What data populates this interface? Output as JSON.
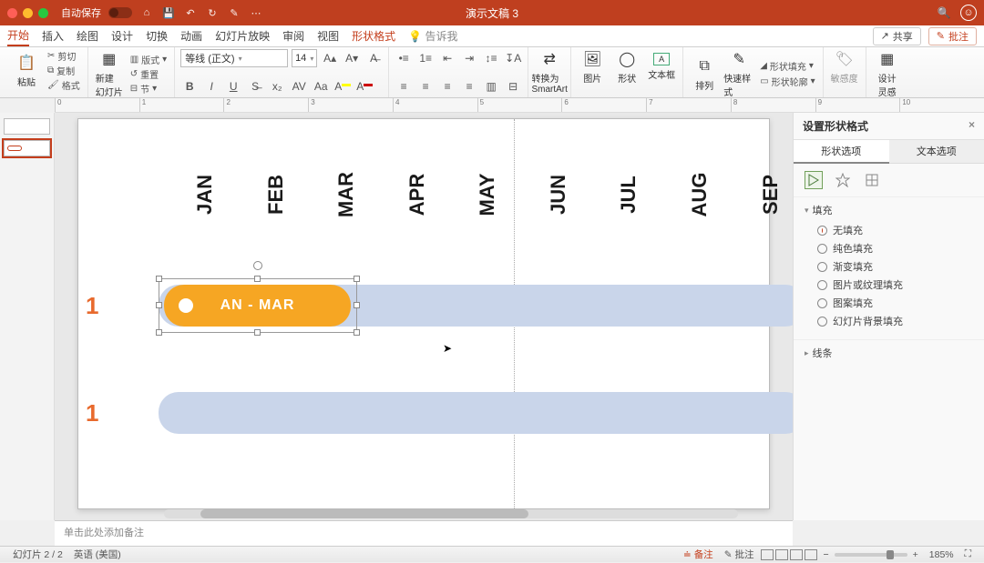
{
  "titlebar": {
    "autosave_label": "自动保存",
    "autosave_state": "关闭",
    "icons": [
      "home-icon",
      "save-icon",
      "undo-icon",
      "redo-icon",
      "touch-icon",
      "more-icon"
    ],
    "doc_title": "演示文稿 3"
  },
  "tabs": {
    "items": [
      "开始",
      "插入",
      "绘图",
      "设计",
      "切换",
      "动画",
      "幻灯片放映",
      "审阅",
      "视图"
    ],
    "context_tab": "形状格式",
    "tell_me": "告诉我",
    "share": "共享",
    "comments": "批注"
  },
  "ribbon": {
    "paste": "粘贴",
    "clipboard": {
      "cut": "剪切",
      "copy": "复制",
      "format": "格式"
    },
    "new_slide": "新建\n幻灯片",
    "layout": "版式",
    "reset": "重置",
    "section": "节",
    "font_name": "等线 (正文)",
    "font_size": "14",
    "font_inc_label": "增大",
    "font_dec_label": "减小",
    "clear_label": "清除",
    "convert": "转换为\nSmartArt",
    "picture": "图片",
    "shapes": "形状",
    "textbox": "文本框",
    "arrange": "排列",
    "quick_styles": "快速样式",
    "shape_fill": "形状填充",
    "shape_outline": "形状轮廓",
    "sensitivity": "敏感度",
    "designer": "设计\n灵感"
  },
  "ruler_ticks": [
    "0",
    "1",
    "2",
    "3",
    "4",
    "5",
    "6",
    "7",
    "8",
    "9",
    "10"
  ],
  "slide": {
    "months": [
      "JAN",
      "FEB",
      "MAR",
      "APR",
      "MAY",
      "JUN",
      "JUL",
      "AUG",
      "SEP"
    ],
    "row_markers": [
      "1",
      "1"
    ],
    "pill_label": "AN - MAR"
  },
  "pane": {
    "title": "设置形状格式",
    "close": "×",
    "tab_shape": "形状选项",
    "tab_text": "文本选项",
    "section_fill": "填充",
    "fill_options": [
      "无填充",
      "纯色填充",
      "渐变填充",
      "图片或纹理填充",
      "图案填充",
      "幻灯片背景填充"
    ],
    "fill_selected_index": 0,
    "section_line": "线条"
  },
  "notes_placeholder": "单击此处添加备注",
  "status": {
    "slide_counter": "幻灯片 2 / 2",
    "language": "英语 (美国)",
    "notes_btn": "备注",
    "comments_btn": "批注",
    "zoom_pct": "185%"
  },
  "thumbs": {
    "count": 2,
    "selected": 2
  }
}
